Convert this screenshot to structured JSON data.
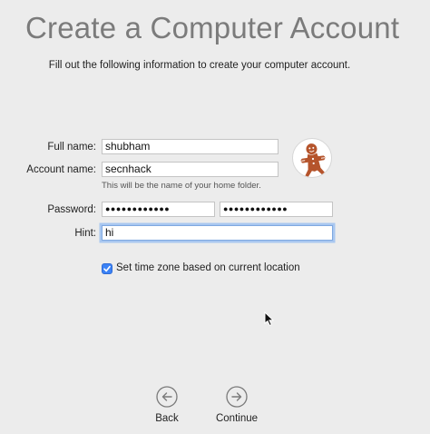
{
  "page": {
    "title": "Create a Computer Account",
    "subtitle": "Fill out the following information to create your computer account."
  },
  "form": {
    "full_name": {
      "label": "Full name:",
      "value": "shubham"
    },
    "account_name": {
      "label": "Account name:",
      "value": "secnhack",
      "help": "This will be the name of your home folder."
    },
    "password": {
      "label": "Password:",
      "value": "●●●●●●●●●●●●",
      "verify_value": "●●●●●●●●●●●●"
    },
    "hint": {
      "label": "Hint:",
      "value": "hi"
    }
  },
  "options": {
    "time_zone": {
      "label": "Set time zone based on current location",
      "checked": true
    }
  },
  "avatar": {
    "icon": "gingerbread-man-icon"
  },
  "nav": {
    "back_label": "Back",
    "continue_label": "Continue"
  },
  "colors": {
    "accent": "#3b82f6",
    "focus_ring": "#a9c7f0",
    "title": "#7b7b7b",
    "background": "#ececec"
  }
}
